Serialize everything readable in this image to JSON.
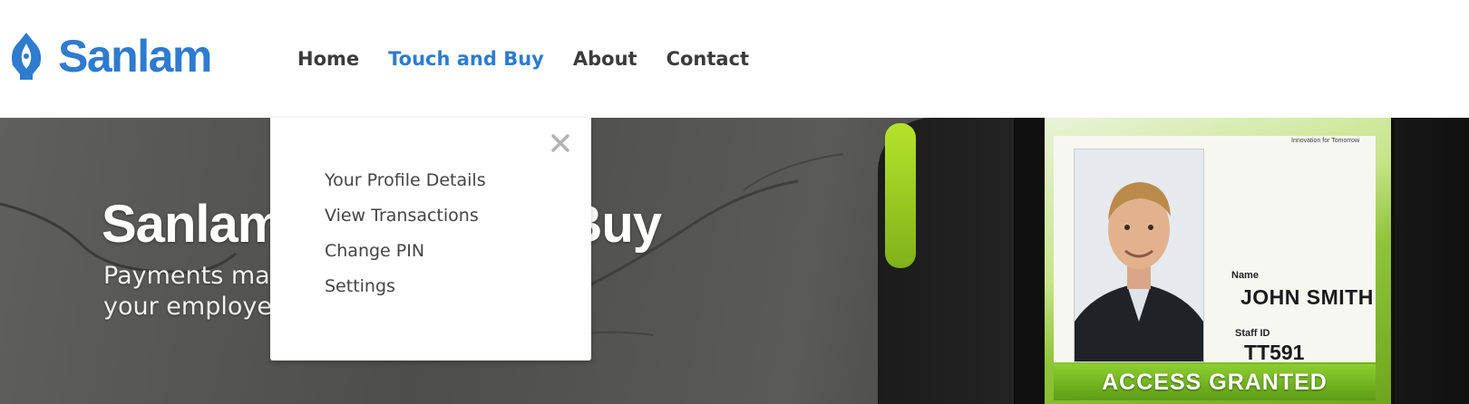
{
  "brand": {
    "name": "Sanlam",
    "color": "#2e7bcf",
    "logo_icon": "sanlam-shield-icon"
  },
  "nav": {
    "items": [
      {
        "label": "Home",
        "active": false
      },
      {
        "label": "Touch and Buy",
        "active": true
      },
      {
        "label": "About",
        "active": false
      },
      {
        "label": "Contact",
        "active": false
      }
    ]
  },
  "hero": {
    "title": "Sanlam Touch and Buy",
    "subtitle": "Payments made easy by simply tapping your employee card"
  },
  "card": {
    "tagline": "Innovation for Tomorrow",
    "name_label": "Name",
    "name": "JOHN SMITH",
    "staff_label": "Staff ID",
    "staff_id": "TT591",
    "banner": "ACCESS GRANTED"
  },
  "dropdown": {
    "close_icon": "close-icon",
    "items": [
      {
        "label": "Your Profile Details"
      },
      {
        "label": "View Transactions"
      },
      {
        "label": "Change PIN"
      },
      {
        "label": "Settings"
      }
    ]
  }
}
